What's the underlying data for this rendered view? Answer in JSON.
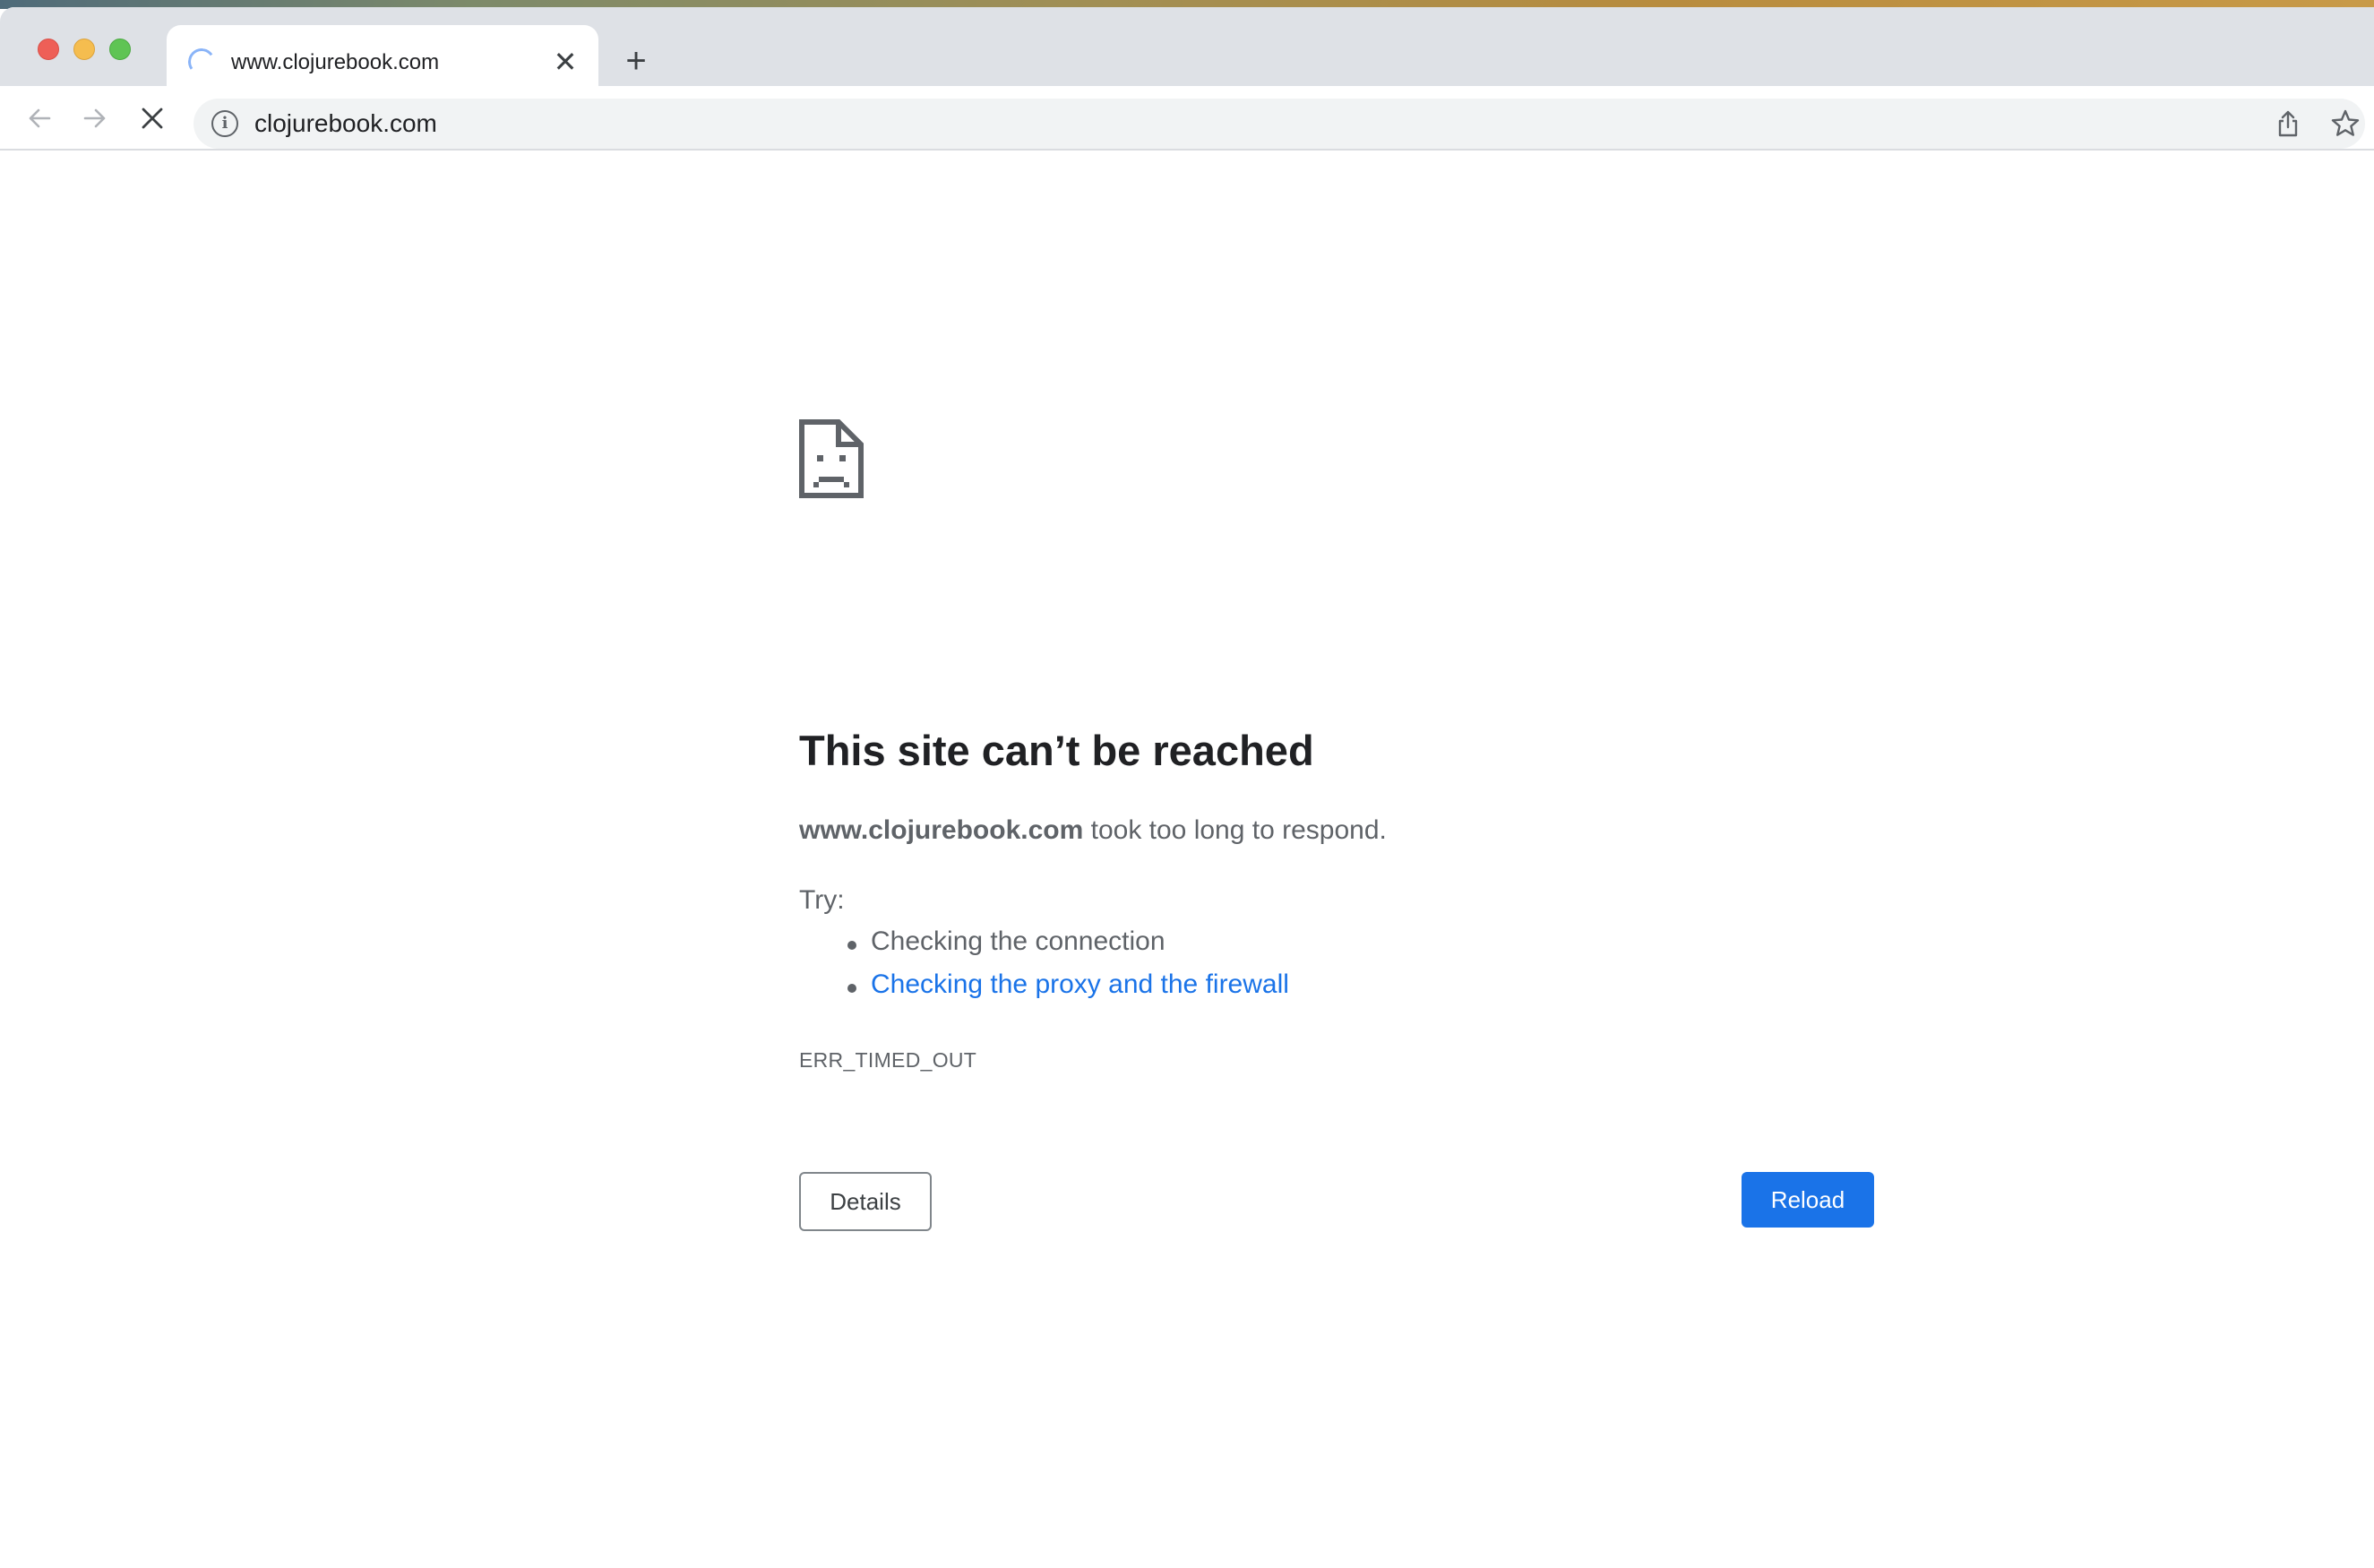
{
  "browser": {
    "tab": {
      "title": "www.clojurebook.com",
      "close_glyph": "✕"
    },
    "new_tab_glyph": "+",
    "omnibox": {
      "url": "clojurebook.com",
      "info_glyph": "i"
    },
    "icons": [
      "back-arrow-icon",
      "forward-arrow-icon",
      "stop-loading-icon",
      "site-info-icon",
      "share-icon",
      "bookmark-star-icon",
      "loading-spinner-icon",
      "sad-page-icon"
    ]
  },
  "error_page": {
    "title": "This site can’t be reached",
    "host": "www.clojurebook.com",
    "description_suffix": " took too long to respond.",
    "try_label": "Try:",
    "suggestions": [
      {
        "text": "Checking the connection",
        "link": false
      },
      {
        "text": "Checking the proxy and the firewall",
        "link": true
      }
    ],
    "error_code": "ERR_TIMED_OUT",
    "details_label": "Details",
    "reload_label": "Reload"
  },
  "colors": {
    "accent": "#1a73e8",
    "tabstrip": "#dee1e6",
    "omnibox": "#f1f3f4",
    "text_primary": "#202124",
    "text_secondary": "#5f6368"
  }
}
